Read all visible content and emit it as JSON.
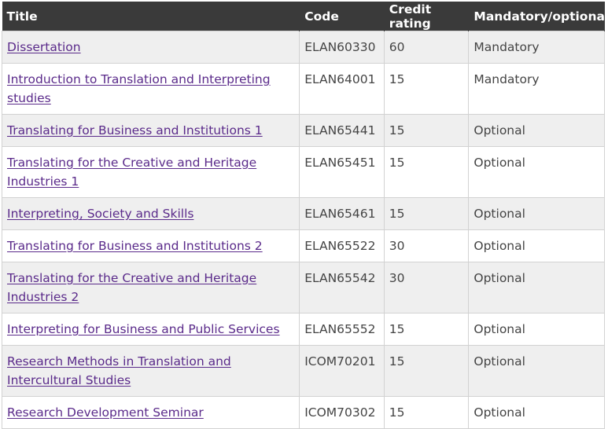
{
  "table": {
    "headers": {
      "title": "Title",
      "code": "Code",
      "credit": "Credit rating",
      "mandatory": "Mandatory/optional"
    },
    "rows": [
      {
        "title": "Dissertation",
        "code": "ELAN60330",
        "credit": "60",
        "mandatory": "Mandatory"
      },
      {
        "title": "Introduction to Translation and Interpreting studies",
        "code": "ELAN64001",
        "credit": "15",
        "mandatory": "Mandatory"
      },
      {
        "title": "Translating for Business and Institutions 1",
        "code": "ELAN65441",
        "credit": "15",
        "mandatory": "Optional"
      },
      {
        "title": "Translating for the Creative and Heritage Industries 1",
        "code": "ELAN65451",
        "credit": "15",
        "mandatory": "Optional"
      },
      {
        "title": "Interpreting, Society and Skills",
        "code": "ELAN65461",
        "credit": "15",
        "mandatory": "Optional"
      },
      {
        "title": "Translating for Business and Institutions 2",
        "code": "ELAN65522",
        "credit": "30",
        "mandatory": "Optional"
      },
      {
        "title": "Translating for the Creative and Heritage Industries 2",
        "code": "ELAN65542",
        "credit": "30",
        "mandatory": "Optional"
      },
      {
        "title": "Interpreting for Business and Public Services",
        "code": "ELAN65552",
        "credit": "15",
        "mandatory": "Optional"
      },
      {
        "title": "Research Methods in Translation and Intercultural Studies",
        "code": "ICOM70201",
        "credit": "15",
        "mandatory": "Optional"
      },
      {
        "title": "Research Development Seminar",
        "code": "ICOM70302",
        "credit": "15",
        "mandatory": "Optional"
      }
    ]
  },
  "colors": {
    "header_bg": "#3a3a3a",
    "link": "#5a2a8a",
    "row_alt": "#efefef",
    "border": "#d2d2d2"
  }
}
